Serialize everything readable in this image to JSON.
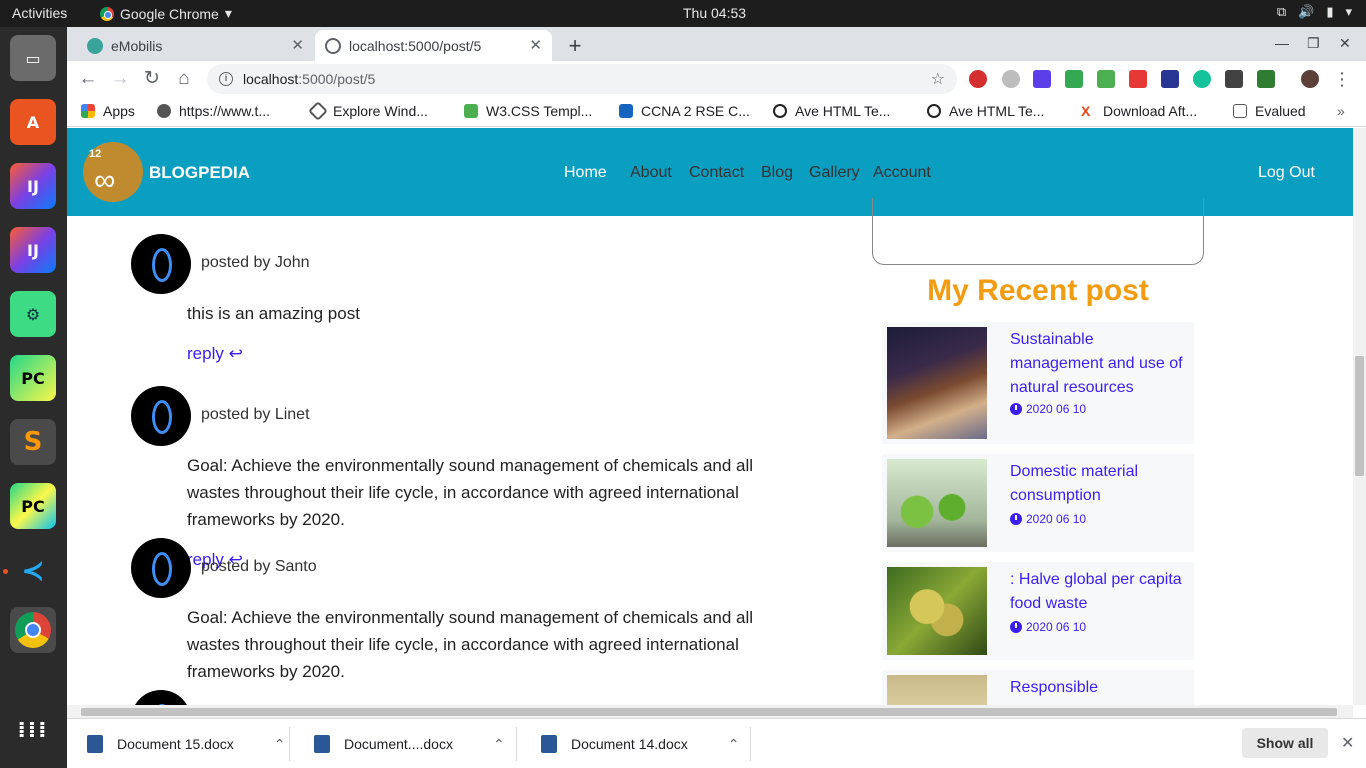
{
  "topbar": {
    "activities": "Activities",
    "app_name": "Google Chrome",
    "clock": "Thu 04:53"
  },
  "browser": {
    "tabs": [
      {
        "title": "eMobilis"
      },
      {
        "title": "localhost:5000/post/5"
      }
    ],
    "url_host": "localhost",
    "url_path": ":5000/post/5",
    "bookmarks": [
      "Apps",
      "https://www.t...",
      "Explore Wind...",
      "W3.CSS Templ...",
      "CCNA 2 RSE C...",
      "Ave HTML Te...",
      "Ave HTML Te...",
      "Download Aft...",
      "Evalued"
    ]
  },
  "page": {
    "brand": "BLOGPEDIA",
    "logo_number": "12",
    "nav": [
      "Home",
      "About",
      "Contact",
      "Blog",
      "Gallery",
      "Account"
    ],
    "logout": "Log Out",
    "comments": [
      {
        "author": "posted by John",
        "text": "this is an amazing post",
        "reply": "reply"
      },
      {
        "author": "posted by Linet",
        "text": "Goal: Achieve the environmentally sound management of chemicals and all wastes throughout their life cycle, in accordance with agreed international frameworks by 2020.",
        "reply": "reply"
      },
      {
        "author": "posted by Santo",
        "text": "Goal: Achieve the environmentally sound management of chemicals and all wastes throughout their life cycle, in accordance with agreed international frameworks by 2020."
      }
    ],
    "recent_title": "My Recent post",
    "recent_posts": [
      {
        "title": "Sustainable management and use of natural resources",
        "date": "2020 06 10"
      },
      {
        "title": "Domestic material consumption",
        "date": "2020 06 10"
      },
      {
        "title": ": Halve global per capita food waste",
        "date": "2020 06 10"
      },
      {
        "title": "Responsible"
      }
    ]
  },
  "downloads": {
    "files": [
      "Document 15.docx",
      "Document....docx",
      "Document 14.docx"
    ],
    "show_all": "Show all"
  }
}
